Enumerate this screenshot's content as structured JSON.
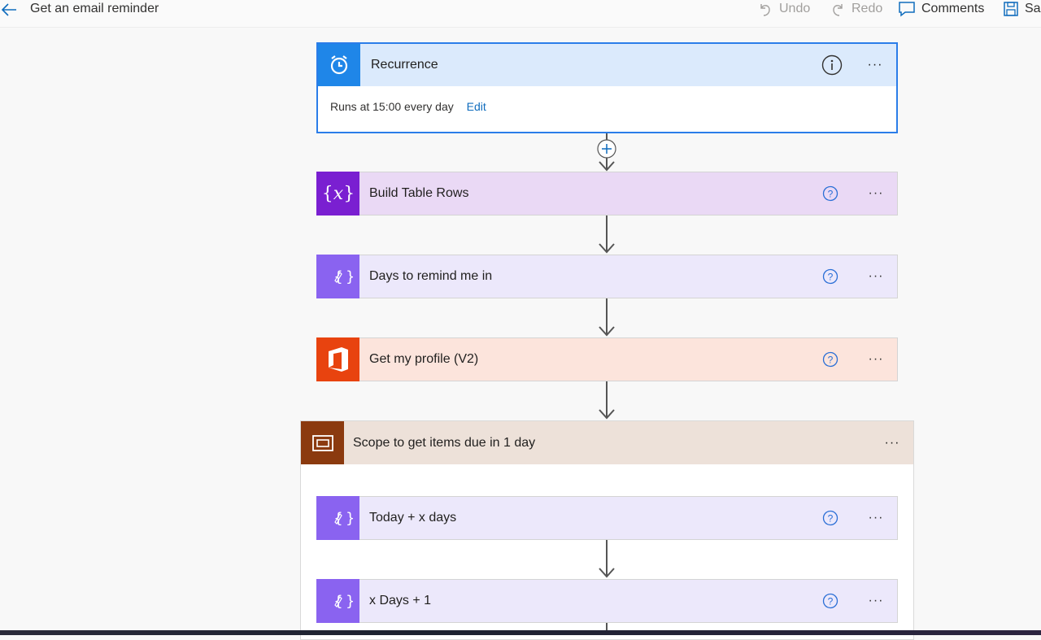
{
  "header": {
    "title": "Get an email reminder",
    "undo_label": "Undo",
    "redo_label": "Redo",
    "comments_label": "Comments",
    "save_label": "Sa"
  },
  "flow": {
    "recurrence": {
      "title": "Recurrence",
      "body": "Runs at 15:00 every day",
      "edit_label": "Edit",
      "color": "#1f86e8"
    },
    "steps": [
      {
        "title": "Build Table Rows",
        "icon": "variable-icon",
        "color": "#7a1fd1",
        "bg": "#ead9f5"
      },
      {
        "title": "Days to remind me in",
        "icon": "data-operation-icon",
        "color": "#8a63f0",
        "bg": "#ece8fb"
      },
      {
        "title": "Get my profile (V2)",
        "icon": "office365-icon",
        "color": "#e8430f",
        "bg": "#fce4dc"
      }
    ],
    "scope": {
      "title": "Scope to get items due in 1 day",
      "color": "#8b3a0f",
      "bg": "#ede1d9",
      "steps": [
        {
          "title": "Today + x days",
          "icon": "data-operation-icon",
          "color": "#8a63f0",
          "bg": "#ece8fb"
        },
        {
          "title": "x Days + 1",
          "icon": "data-operation-icon",
          "color": "#8a63f0",
          "bg": "#ece8fb"
        }
      ]
    },
    "more_label": "···"
  }
}
